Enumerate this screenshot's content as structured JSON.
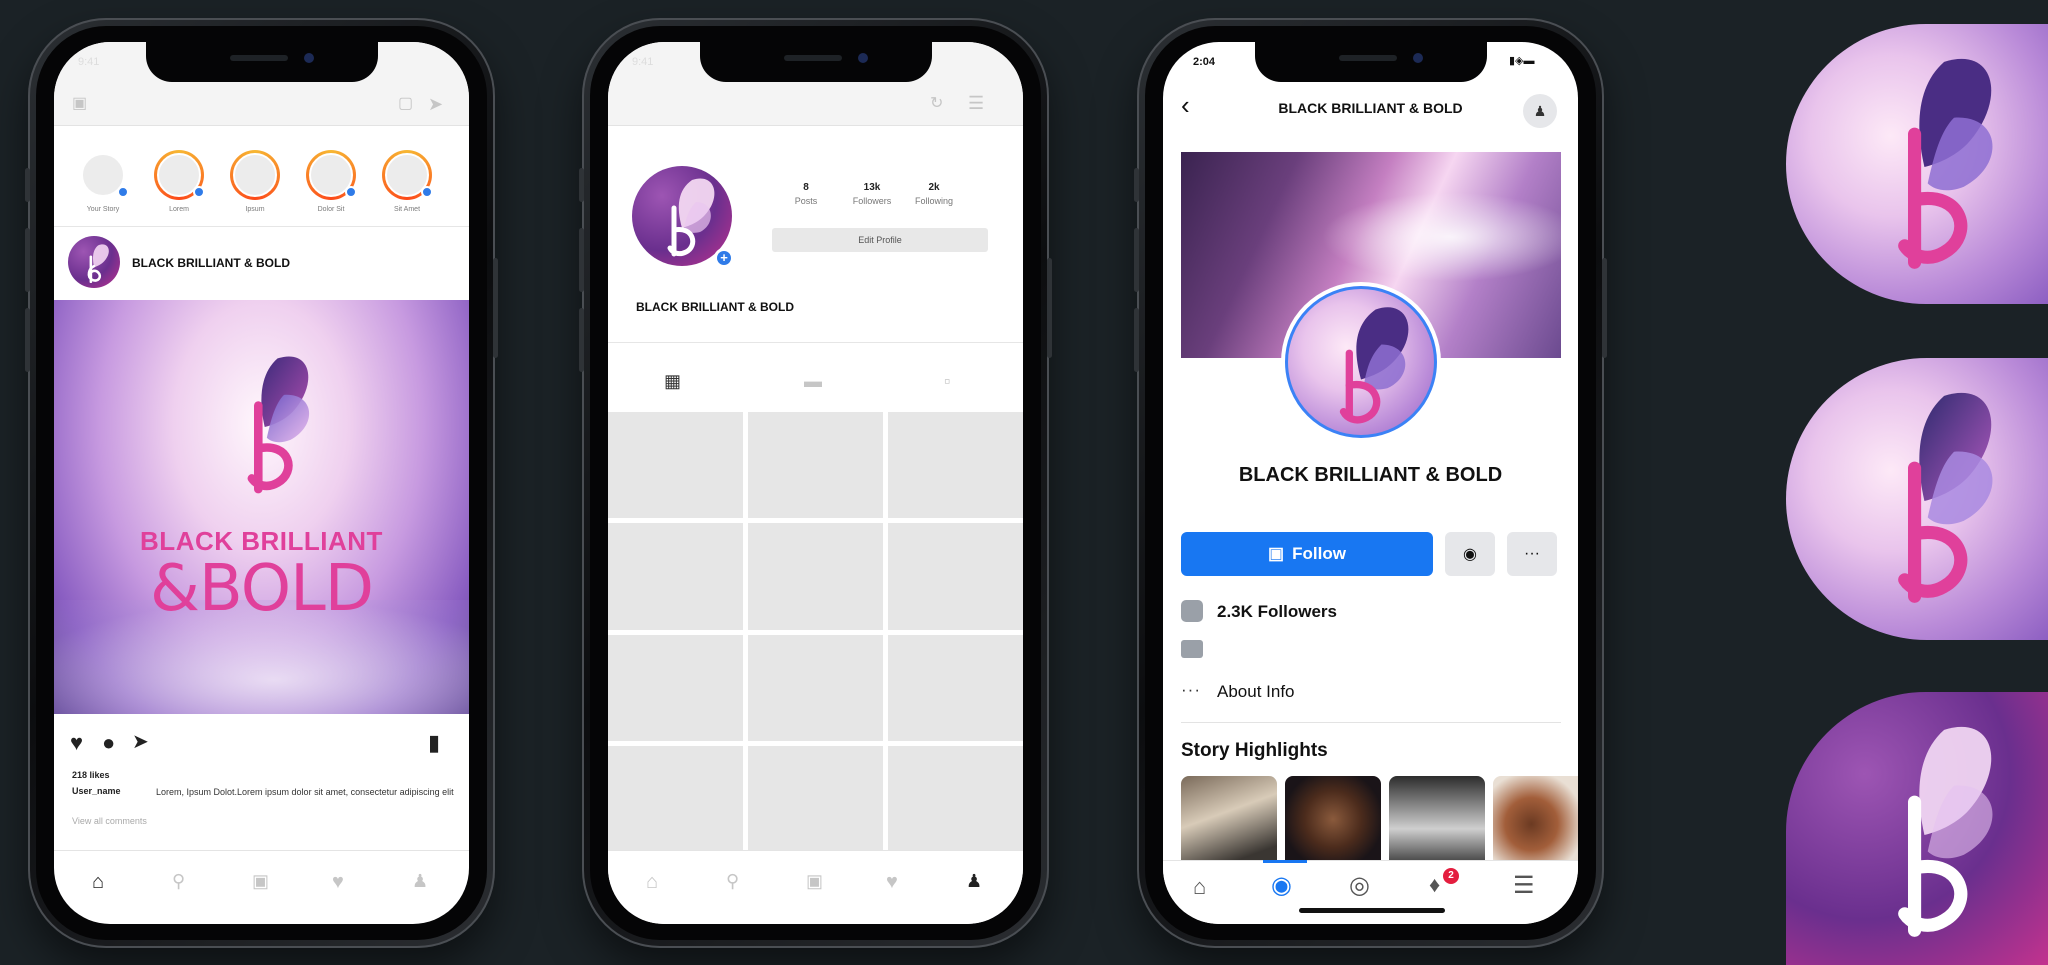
{
  "phone1": {
    "time": "9:41",
    "stories": [
      "Your Story",
      "Lorem",
      "Ipsum",
      "Dolor Sit",
      "Sit Amet"
    ],
    "post_username": "BLACK BRILLIANT & BOLD",
    "post_image_line1": "BLACK BRILLIANT",
    "post_image_line2": "&BOLD",
    "likes": "218 likes",
    "caption_user": "User_name",
    "caption_text": "Lorem, Ipsum Dolot.Lorem ipsum dolor sit amet, consectetur adipiscing elit",
    "view_comments": "View all comments"
  },
  "phone2": {
    "time": "9:41",
    "stats": [
      {
        "value": "8",
        "label": "Posts"
      },
      {
        "value": "13k",
        "label": "Followers"
      },
      {
        "value": "2k",
        "label": "Following"
      }
    ],
    "edit_profile": "Edit Profile",
    "profile_name": "BLACK BRILLIANT & BOLD"
  },
  "phone3": {
    "time": "2:04",
    "header_title": "BLACK BRILLIANT & BOLD",
    "page_name": "BLACK BRILLIANT & BOLD",
    "follow_label": "Follow",
    "more_label": "···",
    "followers": "2.3K Followers",
    "about": "About Info",
    "highlights_title": "Story Highlights",
    "notification_badge": "2"
  },
  "colors": {
    "background": "#1b2226",
    "fb_blue": "#1877f2",
    "brand_pink": "#e0409b",
    "brand_purple": "#6a2f8e"
  }
}
